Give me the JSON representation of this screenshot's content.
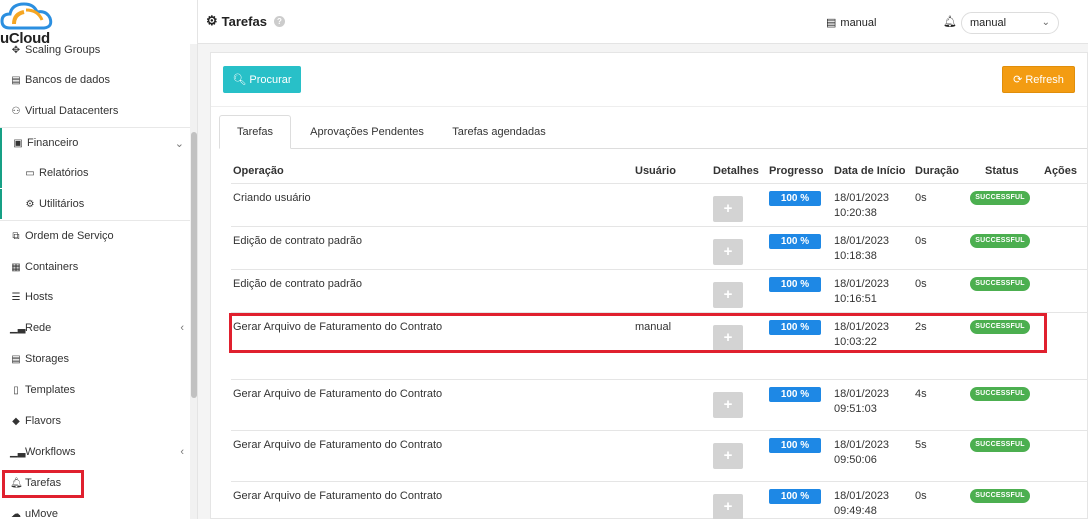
{
  "brand": {
    "logo_text": "uCloud"
  },
  "sidebar": {
    "items": [
      {
        "label": "Scaling Groups",
        "icon": "arrows-icon"
      },
      {
        "label": "Bancos de dados",
        "icon": "database-icon"
      },
      {
        "label": "Virtual Datacenters",
        "icon": "network-icon"
      },
      {
        "label": "Financeiro",
        "icon": "money-icon"
      },
      {
        "label": "Relatórios",
        "icon": "monitor-icon"
      },
      {
        "label": "Utilitários",
        "icon": "cogs-icon"
      },
      {
        "label": "Ordem de Serviço",
        "icon": "clone-icon"
      },
      {
        "label": "Containers",
        "icon": "grid-icon"
      },
      {
        "label": "Hosts",
        "icon": "server-icon"
      },
      {
        "label": "Rede",
        "icon": "signal-icon"
      },
      {
        "label": "Storages",
        "icon": "database-icon"
      },
      {
        "label": "Templates",
        "icon": "file-icon"
      },
      {
        "label": "Flavors",
        "icon": "tag-icon"
      },
      {
        "label": "Workflows",
        "icon": "signal-icon"
      },
      {
        "label": "Tarefas",
        "icon": "bell-icon"
      },
      {
        "label": "uMove",
        "icon": "cloud-upload-icon"
      }
    ]
  },
  "header": {
    "title": "Tarefas",
    "user_label": "manual",
    "select_value": "manual"
  },
  "toolbar": {
    "search_label": "Procurar",
    "refresh_label": "Refresh"
  },
  "tabs": [
    {
      "label": "Tarefas",
      "active": true
    },
    {
      "label": "Aprovações Pendentes",
      "active": false
    },
    {
      "label": "Tarefas agendadas",
      "active": false
    }
  ],
  "table": {
    "columns": [
      "Operação",
      "Usuário",
      "Detalhes",
      "Progresso",
      "Data de Início",
      "Duração",
      "Status",
      "Ações"
    ],
    "rows": [
      {
        "operation": "Criando usuário",
        "user": "",
        "progress": "100 %",
        "date": "18/01/2023",
        "time": "10:20:38",
        "duration": "0s",
        "status": "SUCCESSFUL"
      },
      {
        "operation": "Edição de contrato padrão",
        "user": "",
        "progress": "100 %",
        "date": "18/01/2023",
        "time": "10:18:38",
        "duration": "0s",
        "status": "SUCCESSFUL"
      },
      {
        "operation": "Edição de contrato padrão",
        "user": "",
        "progress": "100 %",
        "date": "18/01/2023",
        "time": "10:16:51",
        "duration": "0s",
        "status": "SUCCESSFUL"
      },
      {
        "operation": "Gerar Arquivo de Faturamento do Contrato",
        "user": "manual",
        "progress": "100 %",
        "date": "18/01/2023",
        "time": "10:03:22",
        "duration": "2s",
        "status": "SUCCESSFUL"
      },
      {
        "operation": "Gerar Arquivo de Faturamento do Contrato",
        "user": "",
        "progress": "100 %",
        "date": "18/01/2023",
        "time": "09:51:03",
        "duration": "4s",
        "status": "SUCCESSFUL"
      },
      {
        "operation": "Gerar Arquivo de Faturamento do Contrato",
        "user": "",
        "progress": "100 %",
        "date": "18/01/2023",
        "time": "09:50:06",
        "duration": "5s",
        "status": "SUCCESSFUL"
      },
      {
        "operation": "Gerar Arquivo de Faturamento do Contrato",
        "user": "",
        "progress": "100 %",
        "date": "18/01/2023",
        "time": "09:49:48",
        "duration": "0s",
        "status": "SUCCESSFUL"
      }
    ]
  },
  "colors": {
    "search_button": "#28c0c8",
    "refresh_button": "#f39c12",
    "progress": "#1e88e5",
    "status_success": "#4caf50",
    "highlight": "#e0202e"
  }
}
